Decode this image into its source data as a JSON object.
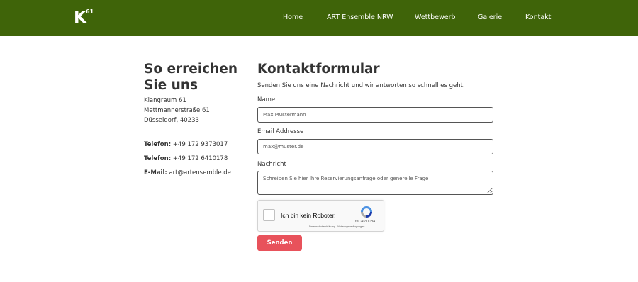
{
  "header": {
    "logo": {
      "letter": "K",
      "superscript": "61"
    },
    "nav": [
      {
        "label": "Home"
      },
      {
        "label": "ART Ensemble NRW"
      },
      {
        "label": "Wettbewerb"
      },
      {
        "label": "Galerie"
      },
      {
        "label": "Kontakt"
      }
    ]
  },
  "contact": {
    "title": "So erreichen Sie uns",
    "address": [
      "Klangraum 61",
      "Mettmannerstraße 61",
      "Düsseldorf, 40233"
    ],
    "details": [
      {
        "label": "Telefon:",
        "value": "+49 172 9373017"
      },
      {
        "label": "Telefon:",
        "value": "+49 172 6410178"
      },
      {
        "label": "E-Mail:",
        "value": "art@artensemble.de"
      }
    ]
  },
  "form": {
    "title": "Kontaktformular",
    "intro": "Senden Sie uns eine Nachricht und wir antworten so schnell es geht.",
    "name": {
      "label": "Name",
      "placeholder": "Max Mustermann"
    },
    "email": {
      "label": "Email Addresse",
      "placeholder": "max@muster.de"
    },
    "message": {
      "label": "Nachricht",
      "placeholder": "Schreiben Sie hier Ihre Reservierungsanfrage oder generelle Frage"
    },
    "recaptcha": {
      "label": "Ich bin kein Roboter.",
      "brand": "reCAPTCHA",
      "terms": "Datenschutzerklärung - Nutzungsbedingungen"
    },
    "submit_label": "Senden"
  },
  "colors": {
    "header_bg": "#3f6409",
    "button_bg": "#e8525b",
    "text": "#333333"
  }
}
